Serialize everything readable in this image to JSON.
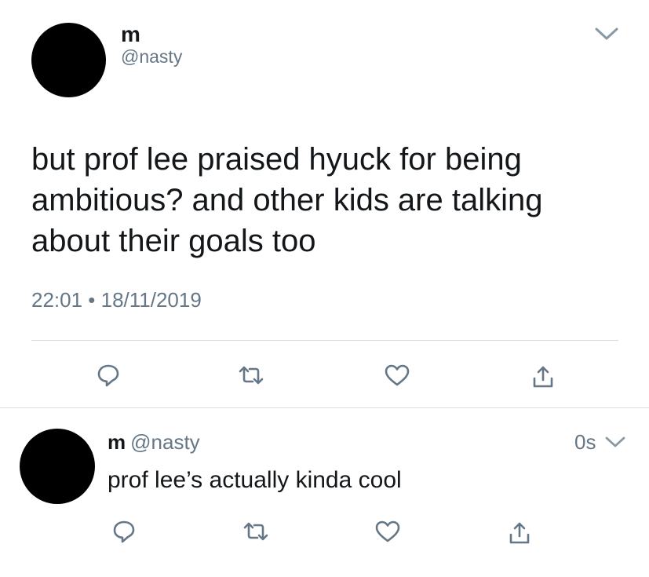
{
  "main_tweet": {
    "name": "m",
    "handle": "@nasty",
    "text": "but prof lee praised hyuck for being\nambitious? and other kids are talking\nabout their goals too",
    "timestamp": "22:01 • 18/11/2019"
  },
  "reply_tweet": {
    "name": "m",
    "handle": "@nasty",
    "time": "0s",
    "text": "prof lee’s actually kinda cool"
  },
  "icons": {
    "reply": "reply-icon",
    "retweet": "retweet-icon",
    "like": "heart-icon",
    "share": "share-icon",
    "more": "chevron-down-icon"
  },
  "colors": {
    "text": "#14171a",
    "secondary": "#657786",
    "icon": "#657786",
    "divider": "#cfd9de",
    "avatar": "#000000"
  }
}
